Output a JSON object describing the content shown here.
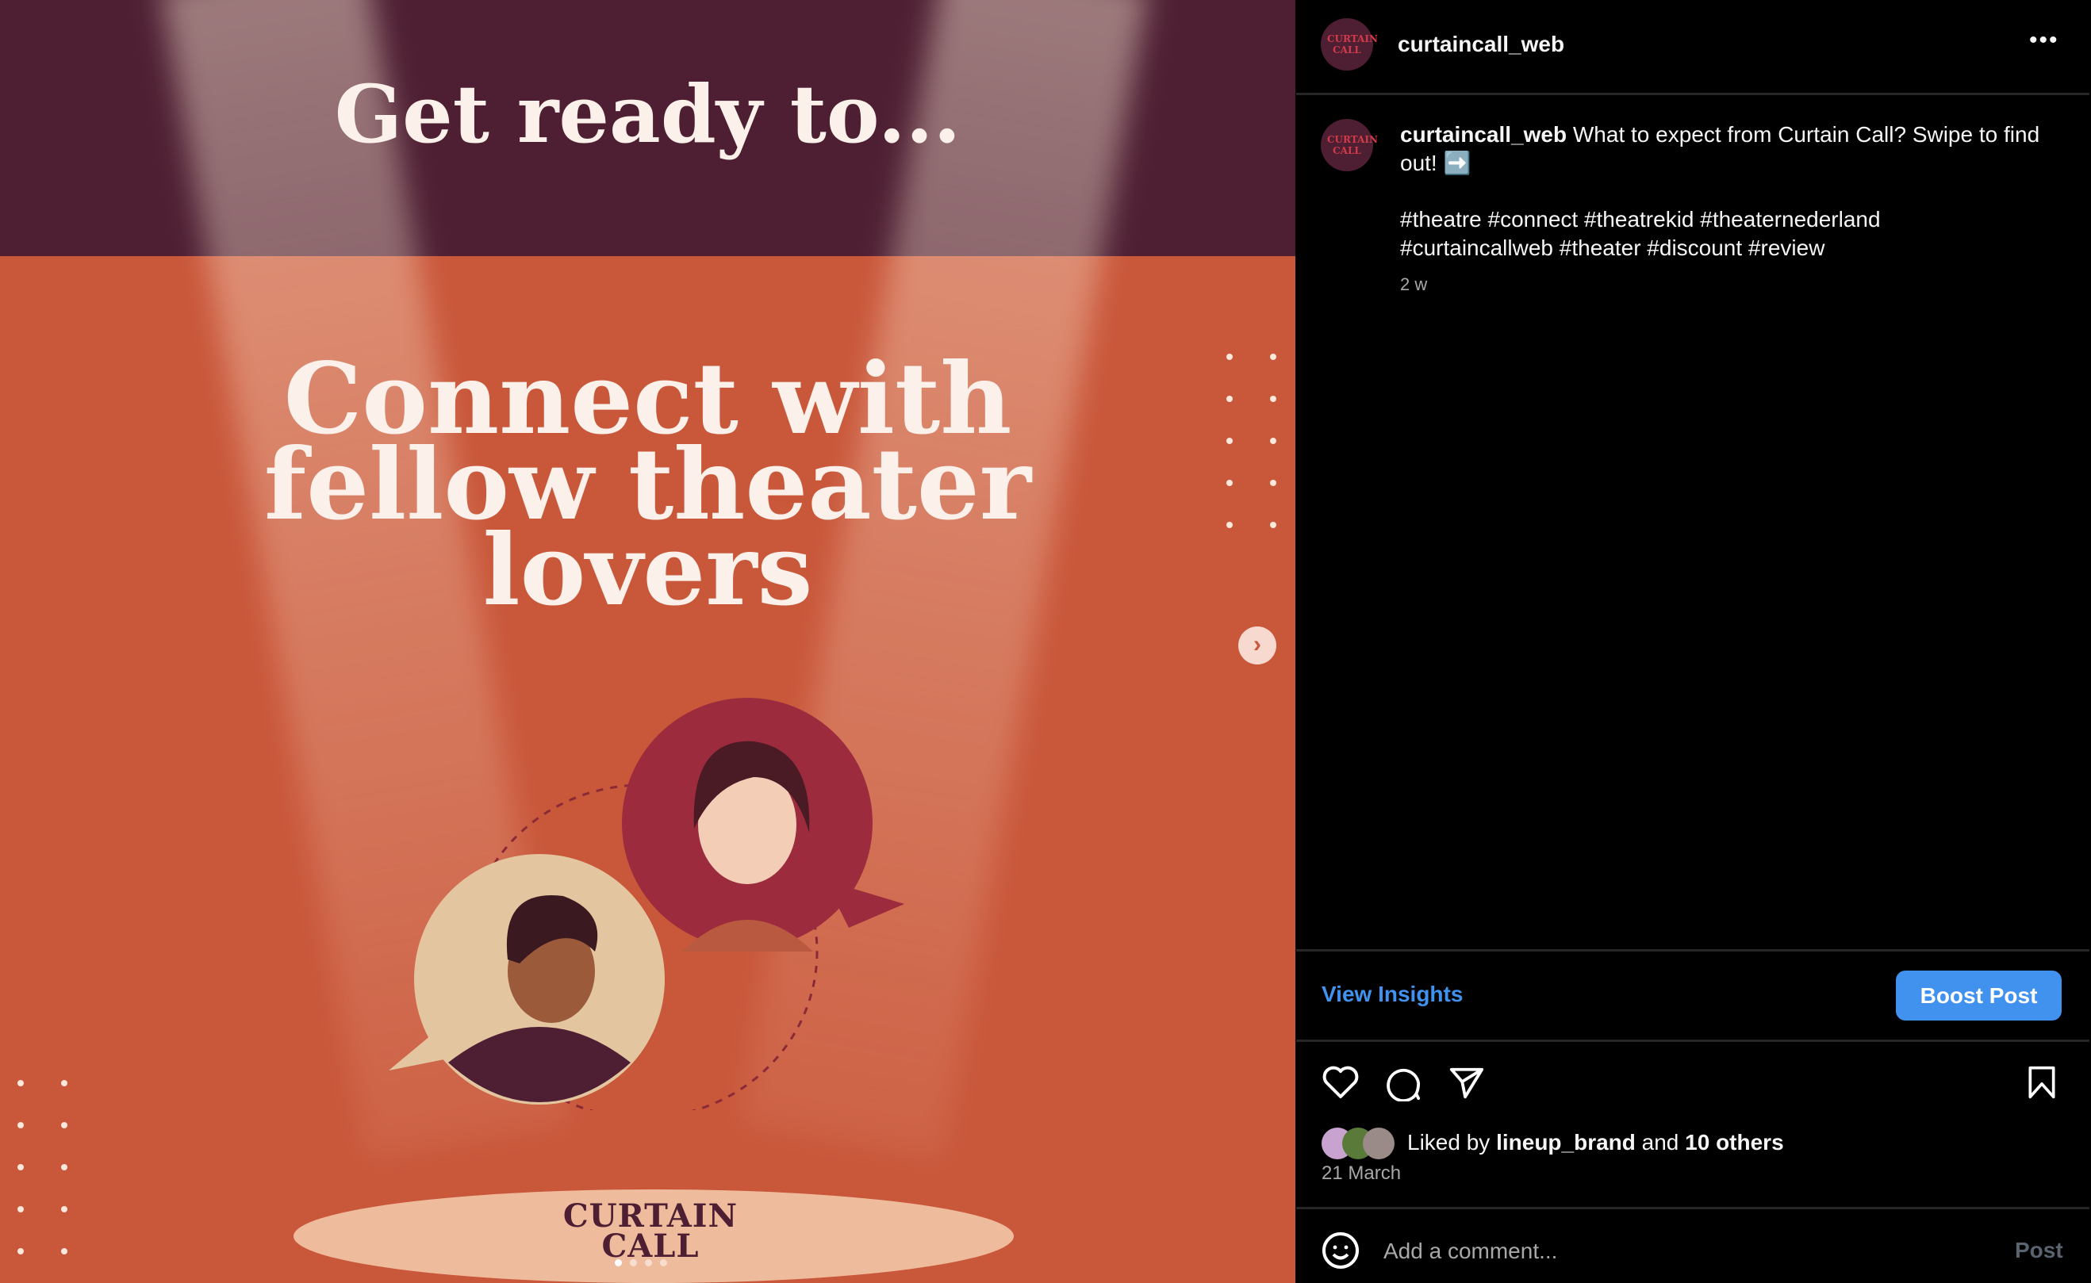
{
  "media": {
    "headline_top": "Get ready to...",
    "headline_main": "Connect with fellow theater lovers",
    "logo_text": "CURTAIN CALL",
    "next_icon": "chevron-right-icon",
    "slide_count": 4,
    "current_slide": 1
  },
  "header": {
    "username": "curtaincall_web",
    "avatar_text": "CURTAIN CALL",
    "more_icon": "more-horizontal-icon"
  },
  "caption": {
    "username": "curtaincall_web",
    "text": "What to expect from Curtain Call? Swipe to find out! ➡️",
    "hashtags_line1": "#theatre #connect #theatrekid #theaternederland",
    "hashtags_line2": "#curtaincallweb #theater #discount #review",
    "time": "2 w"
  },
  "actions": {
    "view_insights": "View Insights",
    "boost_post": "Boost Post",
    "accent": "#4192ef"
  },
  "likes": {
    "prefix": "Liked by",
    "user": "lineup_brand",
    "and": "and",
    "others": "10 others",
    "date": "21 March"
  },
  "comment": {
    "placeholder": "Add a comment...",
    "post": "Post"
  }
}
